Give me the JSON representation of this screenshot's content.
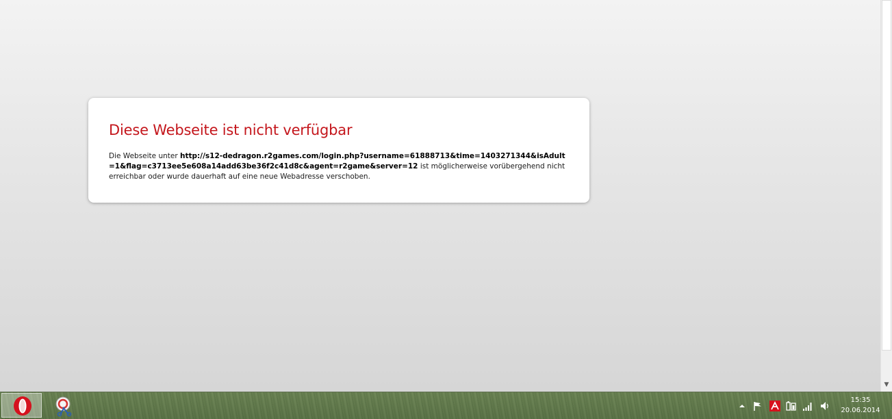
{
  "error": {
    "title": "Diese Webseite ist nicht verfügbar",
    "message_prefix": "Die Webseite unter ",
    "url": "http://s12-dedragon.r2games.com/login.php?username=61888713&time=1403271344&isAdult=1&flag=c3713ee5e608a14add63be36f2c41d8c&agent=r2game&server=12",
    "message_suffix": " ist möglicherweise vorübergehend nicht erreichbar oder wurde dauerhaft auf eine neue Webadresse verschoben.",
    "title_color": "#c4161c"
  },
  "taskbar": {
    "pinned": [
      {
        "name": "opera",
        "icon": "opera-icon",
        "active": true
      },
      {
        "name": "snipping-tool",
        "icon": "snipping-tool-icon",
        "active": false
      }
    ],
    "tray_icons": [
      "show-hidden-icons-icon",
      "action-center-flag-icon",
      "avira-icon",
      "power-icon",
      "network-signal-icon",
      "volume-icon"
    ],
    "clock": {
      "time": "15:35",
      "date": "20.06.2014"
    }
  }
}
